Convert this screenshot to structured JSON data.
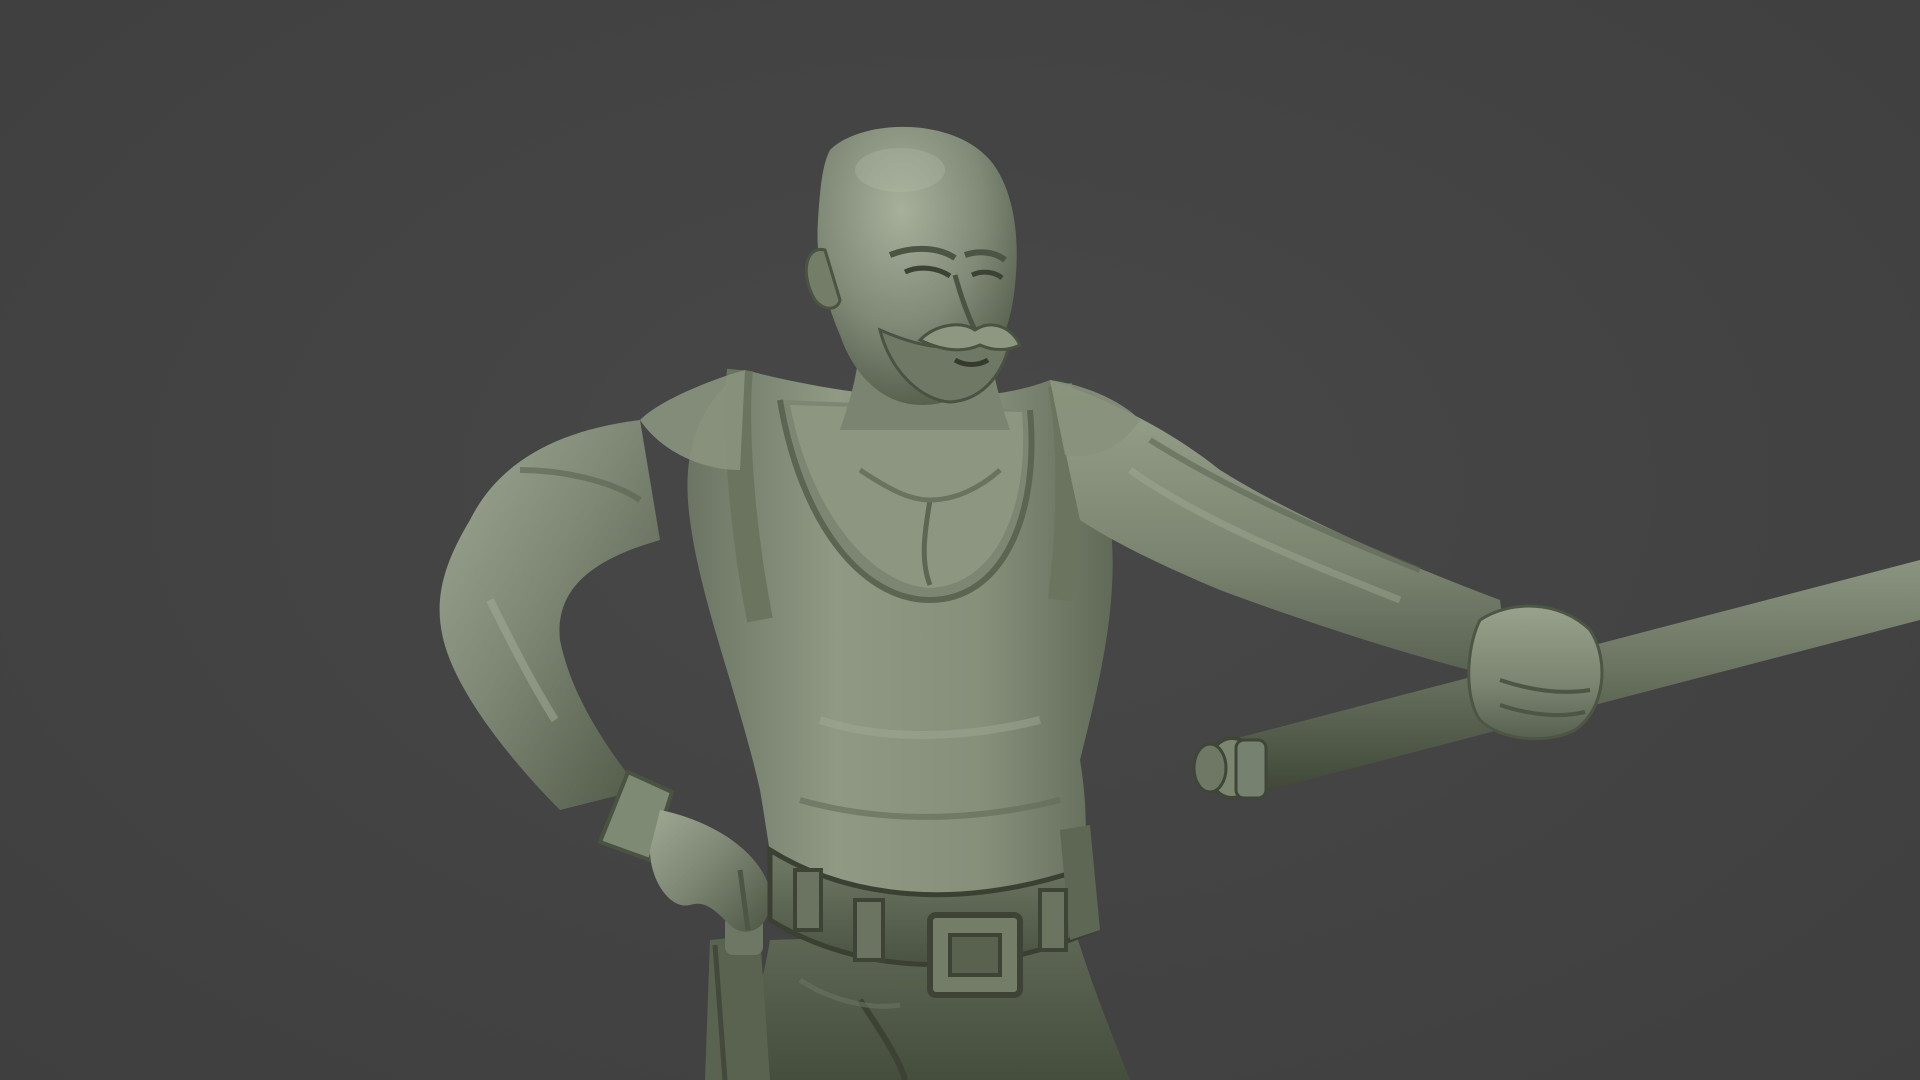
{
  "scene": {
    "subject": "sculpt-figure",
    "colors": {
      "background": "#434343",
      "clay_base": "#7c8673",
      "clay_light": "#a2ab97",
      "clay_shadow": "#48503f",
      "clay_dark": "#343a2e"
    },
    "icons": []
  }
}
